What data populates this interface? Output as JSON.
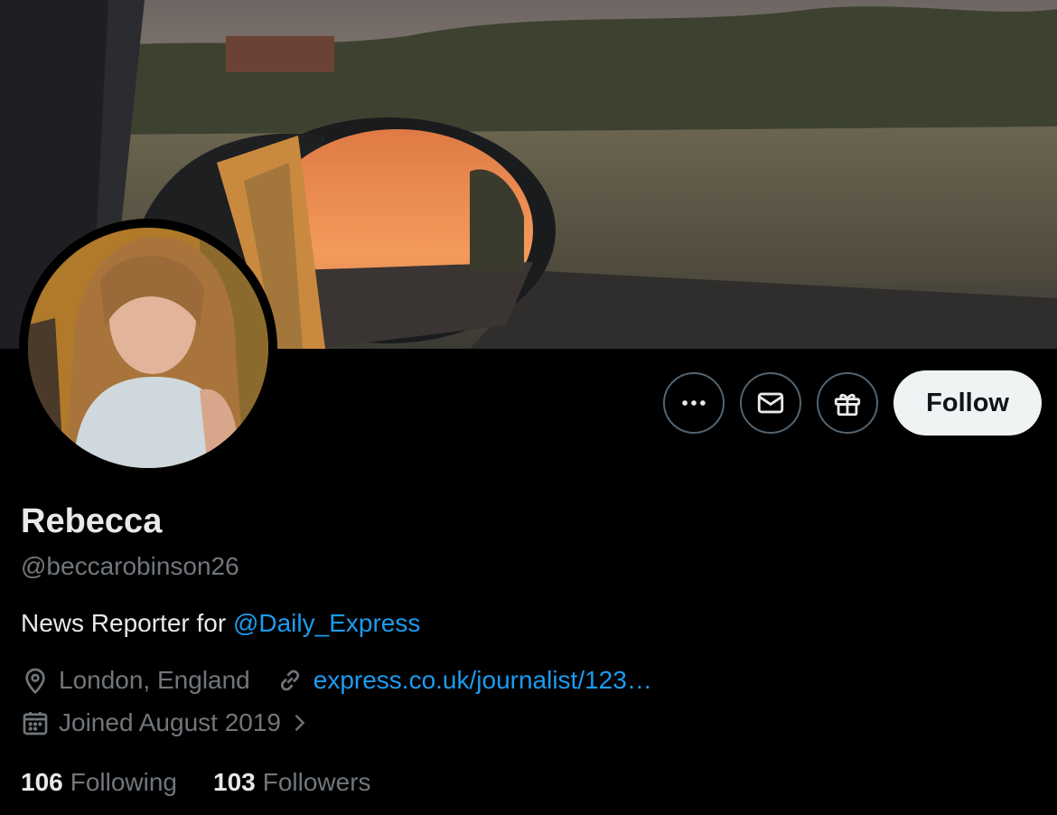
{
  "profile": {
    "name": "Rebecca",
    "handle": "@beccarobinson26",
    "bio_text": "News Reporter for ",
    "bio_mention": "@Daily_Express",
    "location": "London, England",
    "website": "express.co.uk/journalist/123…",
    "joined": "Joined August 2019",
    "following_count": "106",
    "following_label": "Following",
    "followers_count": "103",
    "followers_label": "Followers"
  },
  "actions": {
    "follow_label": "Follow",
    "more_icon": "more-icon",
    "message_icon": "envelope-icon",
    "gift_icon": "gift-icon"
  },
  "colors": {
    "background": "#000000",
    "link": "#1d9bf0",
    "secondary_text": "#71767b",
    "follow_bg": "#eff3f4"
  }
}
